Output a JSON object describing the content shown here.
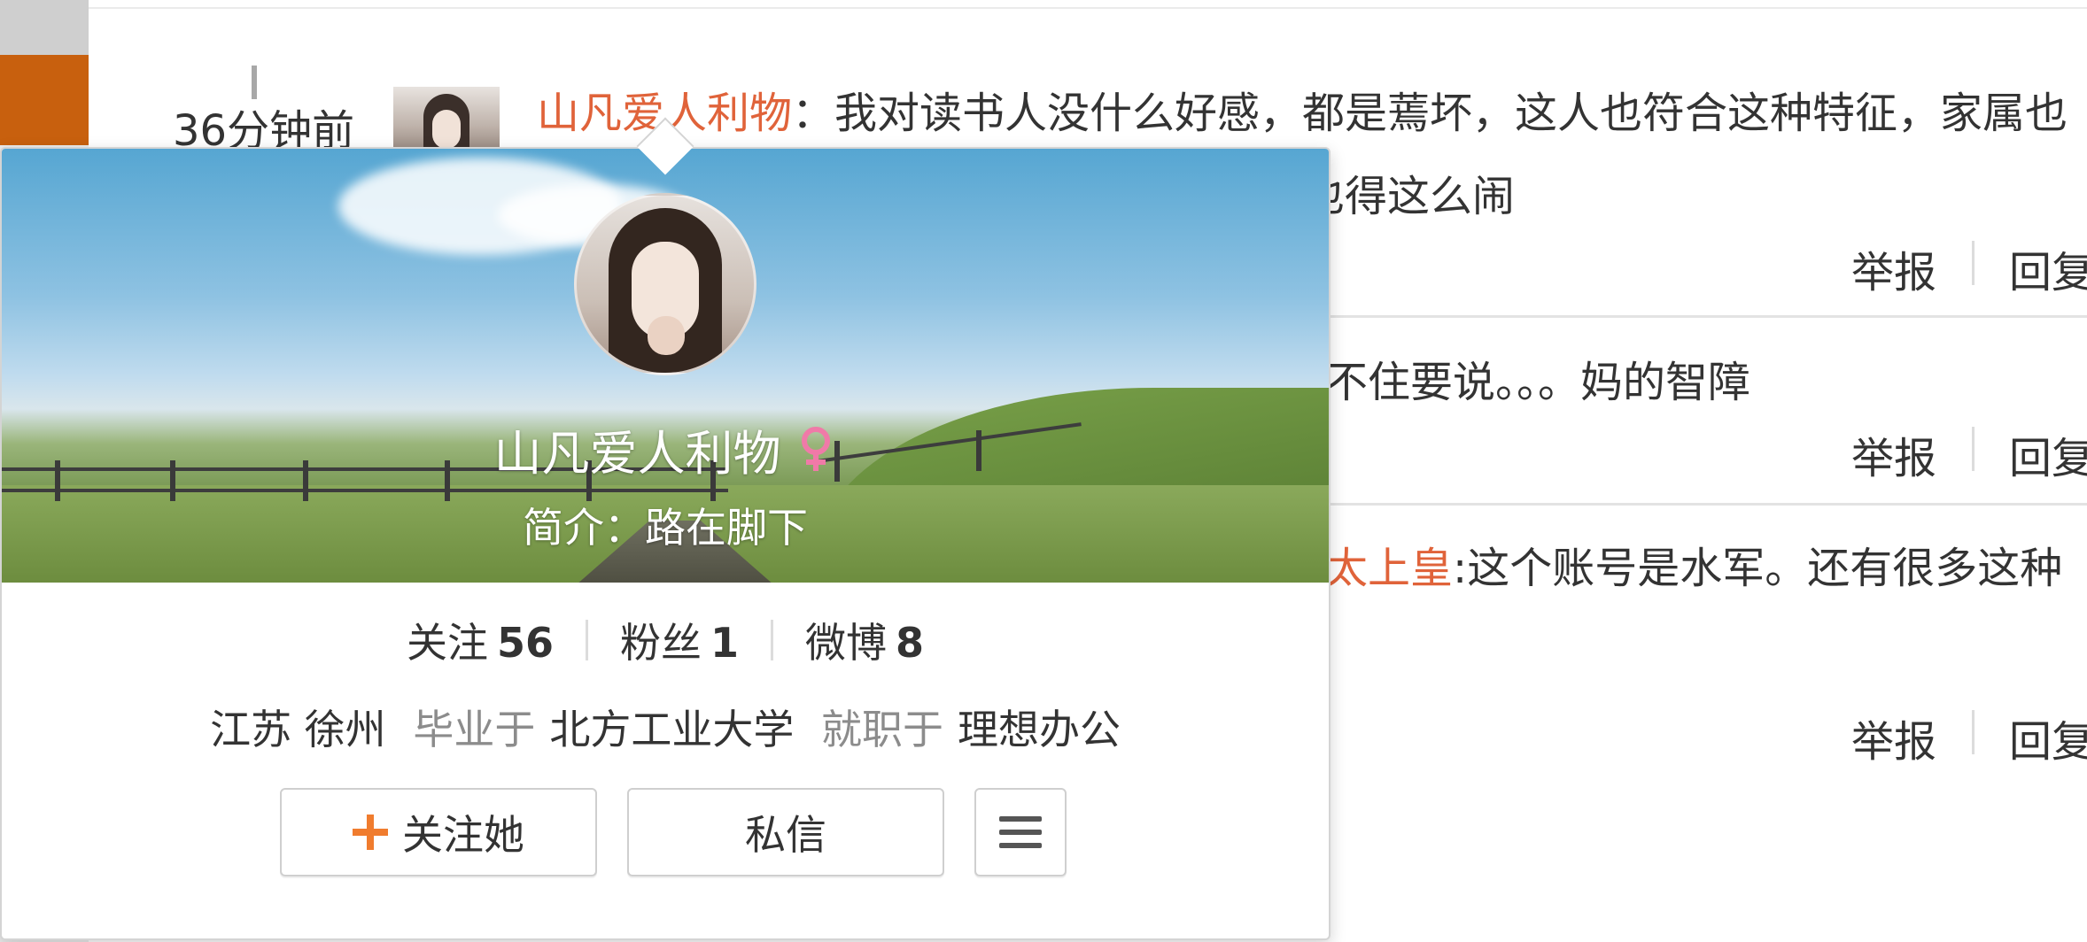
{
  "colors": {
    "accent": "#e0633a",
    "follow_plus": "#f07c2e",
    "muted": "#8c8c8c"
  },
  "comment": {
    "timestamp": "36分钟前",
    "username": "山凡爱人利物",
    "colon": "：",
    "text_line1": "我对读书人没什么好感，都是蔫坏，这人也符合这种特征，家属也",
    "text_line2": "也得这么闹",
    "report": "举报",
    "reply": "回复"
  },
  "comment2": {
    "text": "不住要说。。。妈的智障",
    "report": "举报",
    "reply": "回复"
  },
  "comment3": {
    "username": "太上皇",
    "text": ":这个账号是水军。还有很多这种",
    "report": "举报",
    "reply": "回复"
  },
  "card": {
    "name": "山凡爱人利物",
    "gender_icon": "female-icon",
    "bio_label": "简介：",
    "bio": "路在脚下",
    "stats": [
      {
        "label": "关注",
        "value": "56"
      },
      {
        "label": "粉丝",
        "value": "1"
      },
      {
        "label": "微博",
        "value": "8"
      }
    ],
    "location": "江苏 徐州",
    "edu_label": "毕业于",
    "edu": "北方工业大学",
    "job_label": "就职于",
    "job": "理想办公",
    "follow_button": "关注她",
    "message_button": "私信",
    "menu_icon": "menu-icon"
  }
}
